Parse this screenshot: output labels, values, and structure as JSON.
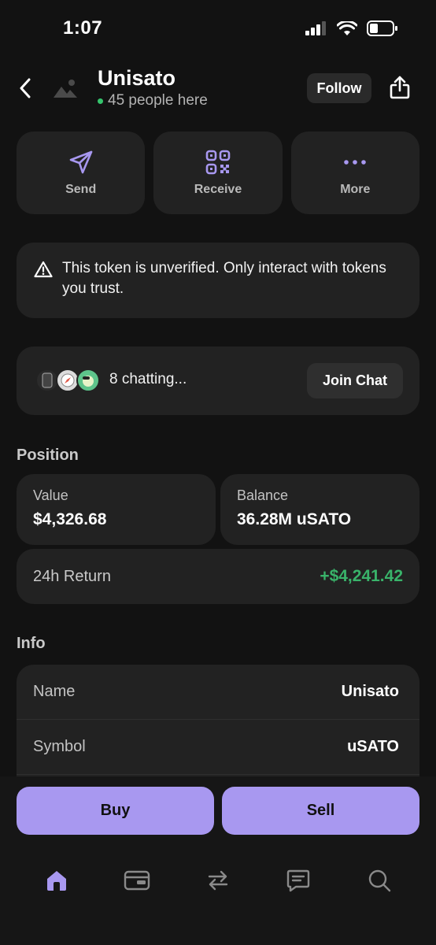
{
  "status_bar": {
    "time": "1:07"
  },
  "header": {
    "title": "Unisato",
    "people_here": "45 people here",
    "follow_label": "Follow"
  },
  "actions": {
    "send": "Send",
    "receive": "Receive",
    "more": "More"
  },
  "warning": {
    "text": "This token is unverified. Only interact with tokens you trust."
  },
  "chat": {
    "chatting": "8 chatting...",
    "join_label": "Join Chat"
  },
  "position": {
    "title": "Position",
    "value_label": "Value",
    "value": "$4,326.68",
    "balance_label": "Balance",
    "balance": "36.28M uSATO",
    "return_label": "24h Return",
    "return_value": "+$4,241.42"
  },
  "info": {
    "title": "Info",
    "rows": [
      {
        "key": "Name",
        "value": "Unisato"
      },
      {
        "key": "Symbol",
        "value": "uSATO"
      }
    ]
  },
  "trade": {
    "buy": "Buy",
    "sell": "Sell"
  },
  "tabs": [
    "home-icon",
    "wallet-icon",
    "swap-icon",
    "messages-icon",
    "search-icon"
  ],
  "colors": {
    "accent": "#a898f0",
    "positive": "#39b36a",
    "card": "#222222",
    "background": "#121212"
  }
}
